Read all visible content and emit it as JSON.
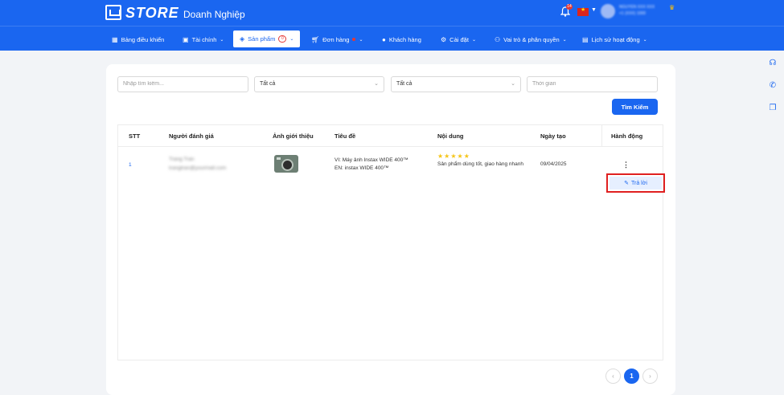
{
  "header": {
    "logo_text": "STORE",
    "brand_sub": "Doanh Nghiệp",
    "bell_badge": "14",
    "user_name": "NGUYEN XXX XXX",
    "user_phone": "+1 (XXX) 1000"
  },
  "nav": {
    "items": [
      {
        "label": "Bảng điều khiển",
        "icon": "dashboard-icon"
      },
      {
        "label": "Tài chính",
        "icon": "wallet-icon"
      },
      {
        "label": "Sản phẩm",
        "icon": "layers-icon",
        "badge": "0"
      },
      {
        "label": "Đơn hàng",
        "icon": "cart-icon"
      },
      {
        "label": "Khách hàng",
        "icon": "user-icon"
      },
      {
        "label": "Cài đặt",
        "icon": "gear-icon"
      },
      {
        "label": "Vai trò & phân quyền",
        "icon": "roles-icon"
      },
      {
        "label": "Lịch sử hoạt động",
        "icon": "history-icon"
      }
    ]
  },
  "filters": {
    "search_placeholder": "Nhập tìm kiếm...",
    "select1_value": "Tất cả",
    "select2_value": "Tất cả",
    "time_placeholder": "Thời gian",
    "search_button": "Tìm Kiếm"
  },
  "table": {
    "columns": [
      "STT",
      "Người đánh giá",
      "Ảnh giới thiệu",
      "Tiêu đề",
      "Nội dung",
      "Ngày tạo",
      "Hành động"
    ],
    "rows": [
      {
        "stt": "1",
        "reviewer_name": "Trang Tran",
        "reviewer_email": "trangtran@yourmail.com",
        "title_vi": "VI: Máy ảnh Instax WIDE 400™",
        "title_en": "EN: instax WIDE 400™",
        "stars": "★★★★★",
        "content": "Sản phẩm dùng tốt, giao hàng nhanh",
        "created": "09/04/2025",
        "action_menu": "⋮",
        "reply_label": "Trả lời"
      }
    ]
  },
  "pagination": {
    "prev": "‹",
    "current": "1",
    "next": "›"
  }
}
